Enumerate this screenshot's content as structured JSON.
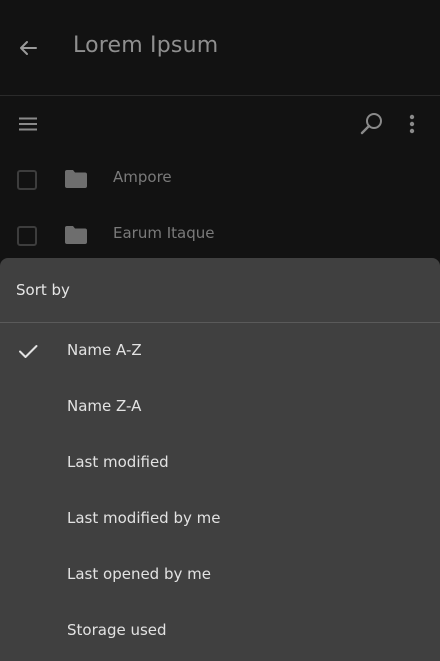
{
  "header": {
    "title": "Lorem Ipsum",
    "back_icon": "arrow-back-icon"
  },
  "toolbar": {
    "menu_icon": "hamburger-menu-icon",
    "search_icon": "search-icon",
    "more_icon": "more-vertical-icon"
  },
  "files": [
    {
      "name": "Ampore",
      "icon": "folder-icon"
    },
    {
      "name": "Earum Itaque",
      "icon": "folder-icon"
    }
  ],
  "sort_sheet": {
    "title": "Sort by",
    "selected": "Name A-Z",
    "options": [
      {
        "label": "Name A-Z"
      },
      {
        "label": "Name Z-A"
      },
      {
        "label": "Last modified"
      },
      {
        "label": "Last modified by me"
      },
      {
        "label": "Last opened by me"
      },
      {
        "label": "Storage used"
      }
    ]
  },
  "colors": {
    "background": "#121212",
    "sheet": "#404040",
    "sheet_text": "#e2e2e2",
    "muted_text": "#8a8a8a"
  }
}
